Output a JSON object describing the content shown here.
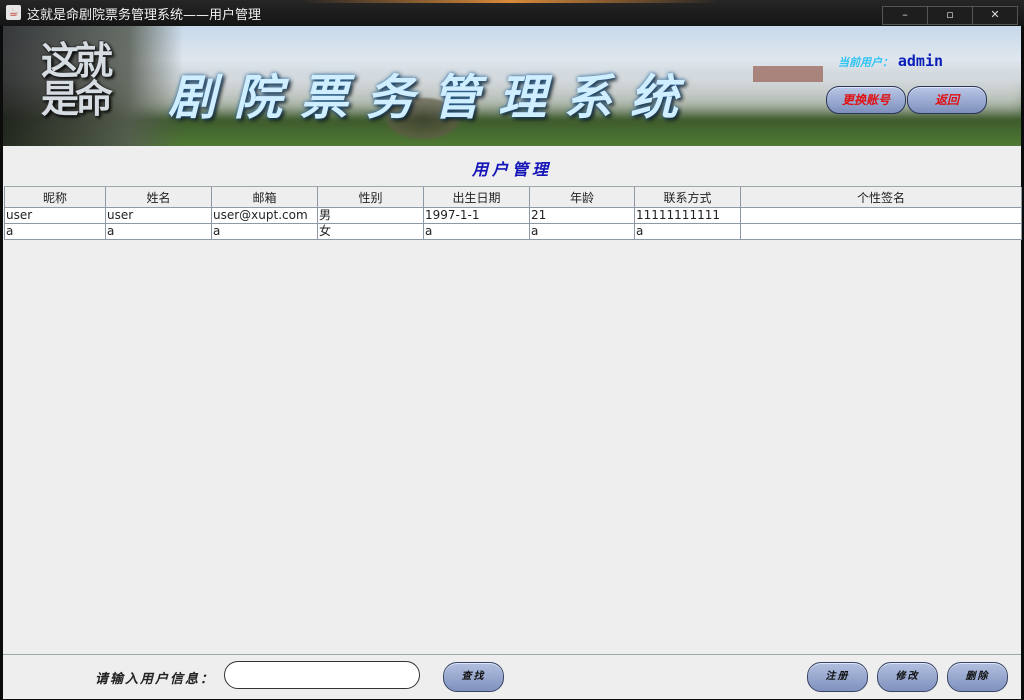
{
  "window": {
    "title": "这就是命剧院票务管理系统——用户管理",
    "app_icon": "java-cup-icon",
    "controls": [
      "–",
      "▫",
      "✕"
    ]
  },
  "banner": {
    "logo_text": "这就是命",
    "system_title": "剧院票务管理系统",
    "current_user_label": "当前用户：",
    "current_user": "admin",
    "switch_account_label": "更换账号",
    "back_label": "返回"
  },
  "page": {
    "heading": "用户管理"
  },
  "table": {
    "columns": [
      "昵称",
      "姓名",
      "邮箱",
      "性别",
      "出生日期",
      "年龄",
      "联系方式",
      "个性签名"
    ],
    "rows": [
      [
        "user",
        "user",
        "user@xupt.com",
        "男",
        "1997-1-1",
        "21",
        "11111111111",
        ""
      ],
      [
        "a",
        "a",
        "a",
        "女",
        "a",
        "a",
        "a",
        ""
      ]
    ]
  },
  "footer": {
    "search_label": "请输入用户信息：",
    "search_value": "",
    "find_label": "查找",
    "register_label": "注册",
    "edit_label": "修改",
    "delete_label": "删除"
  },
  "colors": {
    "heading": "#1515b8",
    "pill_text": "#e01010",
    "user_label": "#2ec4f2",
    "user_value": "#0a1fb8"
  }
}
